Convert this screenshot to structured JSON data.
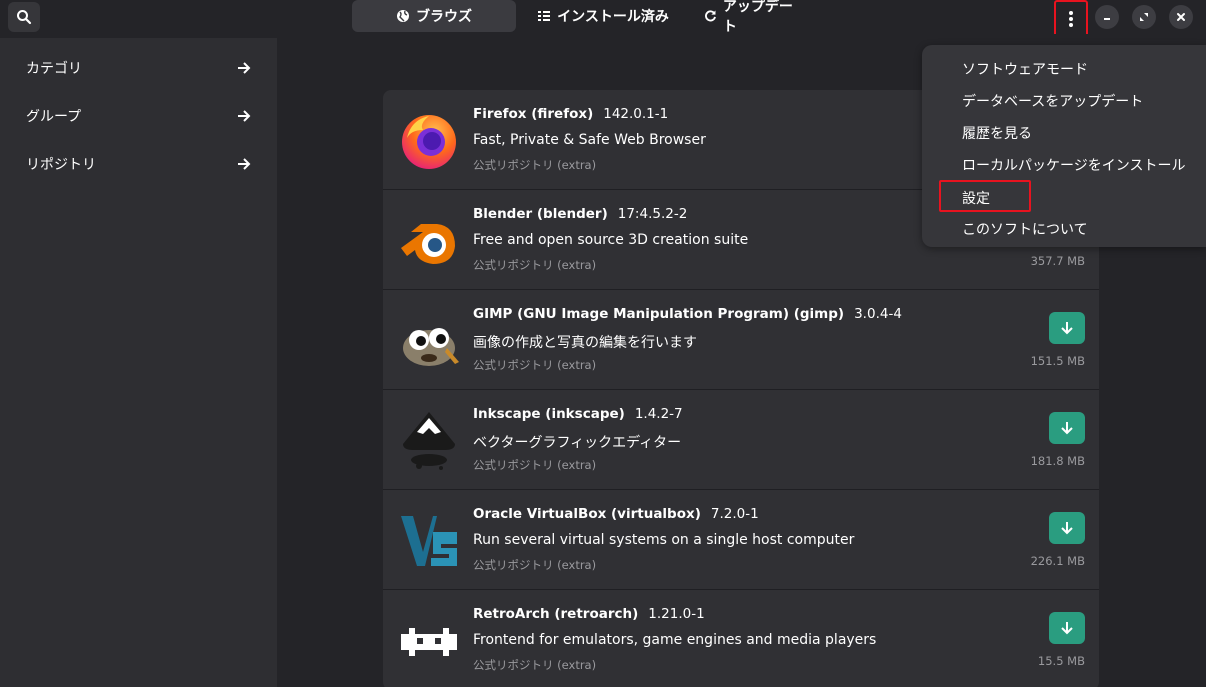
{
  "header": {
    "tabs": [
      {
        "label": "ブラウズ",
        "icon": "globe-icon"
      },
      {
        "label": "インストール済み",
        "icon": "list-icon"
      },
      {
        "label": "アップデート",
        "icon": "refresh-icon"
      }
    ]
  },
  "sidebar": {
    "items": [
      {
        "label": "カテゴリ"
      },
      {
        "label": "グループ"
      },
      {
        "label": "リポジトリ"
      }
    ]
  },
  "menu": {
    "items": [
      {
        "label": "ソフトウェアモード"
      },
      {
        "label": "データベースをアップデート"
      },
      {
        "label": "履歴を見る"
      },
      {
        "label": "ローカルパッケージをインストール"
      },
      {
        "label": "設定"
      },
      {
        "label": "このソフトについて"
      }
    ]
  },
  "packages": [
    {
      "name": "Firefox (firefox)",
      "version": "142.0.1-1",
      "description": "Fast, Private & Safe Web Browser",
      "repo": "公式リポジトリ (extra)",
      "size": "",
      "icon": "firefox-icon"
    },
    {
      "name": "Blender (blender)",
      "version": "17:4.5.2-2",
      "description": "Free and open source 3D creation suite",
      "repo": "公式リポジトリ (extra)",
      "size": "357.7 MB",
      "icon": "blender-icon"
    },
    {
      "name": "GIMP (GNU Image Manipulation Program) (gimp)",
      "version": "3.0.4-4",
      "description": "画像の作成と写真の編集を行います",
      "repo": "公式リポジトリ (extra)",
      "size": "151.5 MB",
      "icon": "gimp-icon"
    },
    {
      "name": "Inkscape (inkscape)",
      "version": "1.4.2-7",
      "description": "ベクターグラフィックエディター",
      "repo": "公式リポジトリ (extra)",
      "size": "181.8 MB",
      "icon": "inkscape-icon"
    },
    {
      "name": "Oracle VirtualBox (virtualbox)",
      "version": "7.2.0-1",
      "description": "Run several virtual systems on a single host computer",
      "repo": "公式リポジトリ (extra)",
      "size": "226.1 MB",
      "icon": "virtualbox-icon"
    },
    {
      "name": "RetroArch (retroarch)",
      "version": "1.21.0-1",
      "description": "Frontend for emulators, game engines and media players",
      "repo": "公式リポジトリ (extra)",
      "size": "15.5 MB",
      "icon": "retroarch-icon"
    }
  ],
  "colors": {
    "accent": "#2a9d80",
    "highlight": "#e8131f"
  }
}
